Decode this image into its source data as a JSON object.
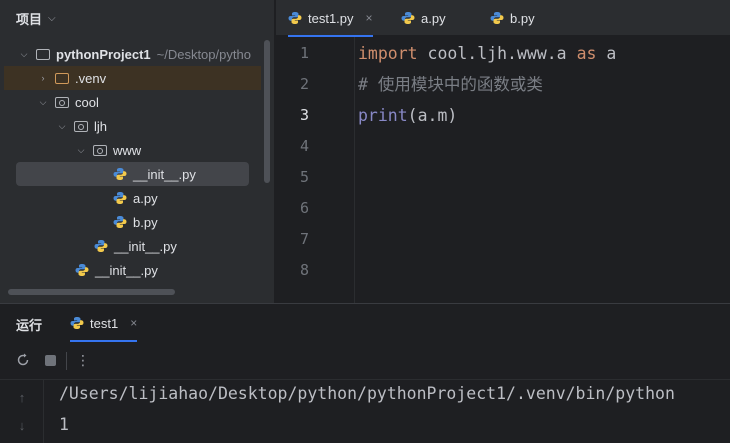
{
  "project": {
    "header": "项目",
    "tree": [
      {
        "label": "pythonProject1",
        "extra": "~/Desktop/pytho",
        "kind": "folder"
      },
      {
        "label": ".venv",
        "kind": "folder-excluded"
      },
      {
        "label": "cool",
        "kind": "package"
      },
      {
        "label": "ljh",
        "kind": "package"
      },
      {
        "label": "www",
        "kind": "package"
      },
      {
        "label": "__init__.py",
        "kind": "python-file"
      },
      {
        "label": "a.py",
        "kind": "python-file"
      },
      {
        "label": "b.py",
        "kind": "python-file"
      },
      {
        "label": "__init__.py",
        "kind": "python-file"
      },
      {
        "label": "__init__.py",
        "kind": "python-file"
      }
    ]
  },
  "tabs": [
    {
      "label": "test1.py",
      "active": true,
      "close": "×"
    },
    {
      "label": "a.py",
      "active": false
    },
    {
      "label": "b.py",
      "active": false
    }
  ],
  "editor": {
    "line_numbers": [
      "1",
      "2",
      "3",
      "4",
      "5",
      "6",
      "7",
      "8"
    ],
    "current_line": 3,
    "line1": {
      "kw_import": "import",
      "module": " cool.ljh.www.a ",
      "kw_as": "as",
      "alias": " a"
    },
    "line2": {
      "comment": "# 使用模块中的函数或类"
    },
    "line3": {
      "fn": "print",
      "args": "(a.m)"
    }
  },
  "run": {
    "title": "运行",
    "tab_label": "test1",
    "tab_close": "×",
    "toolbar": {
      "rerun_icon": "rerun-icon",
      "stop_icon": "stop-icon",
      "more_icon": "more-vertical-icon"
    },
    "console": [
      "/Users/lijiahao/Desktop/python/pythonProject1/.venv/bin/python",
      "1"
    ]
  },
  "colors": {
    "accent": "#3574f0",
    "keyword": "#cf8e6d",
    "comment": "#7a7e85",
    "builtin": "#8888c6"
  }
}
